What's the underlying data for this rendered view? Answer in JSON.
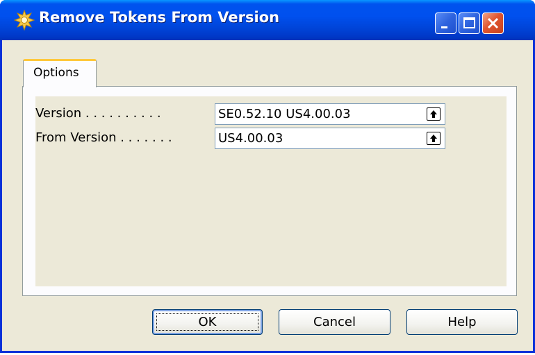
{
  "window": {
    "title": "Remove Tokens From Version",
    "icon": "gear-icon"
  },
  "titlebar_buttons": {
    "minimize_icon": "minimize-icon",
    "maximize_icon": "maximize-icon",
    "close_icon": "close-icon"
  },
  "tabs": [
    {
      "label": "Options",
      "selected": true
    }
  ],
  "fields": {
    "version": {
      "label": "Version . . . . . . . . . .",
      "value": "SE0.52.10 US4.00.03",
      "icon": "lookup-arrow-icon"
    },
    "from_version": {
      "label": "From Version . . . . . . .",
      "value": "US4.00.03",
      "icon": "lookup-arrow-icon"
    }
  },
  "buttons": {
    "ok": "OK",
    "cancel": "Cancel",
    "help": "Help"
  },
  "colors": {
    "titlebar": "#0054e3",
    "dialog_bg": "#ece9d8",
    "tab_highlight": "#ffc83c",
    "close_button": "#e0552f"
  }
}
